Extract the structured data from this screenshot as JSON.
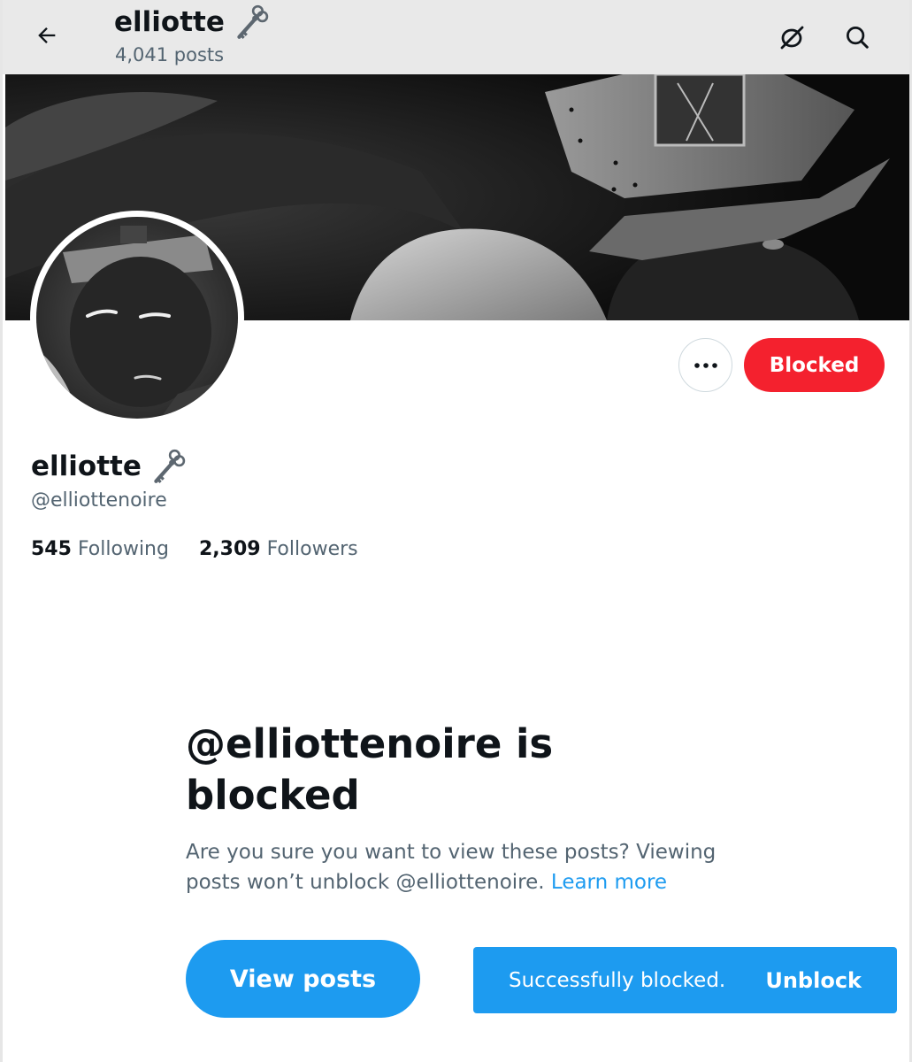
{
  "header": {
    "title": "elliotte",
    "posts_count": "4,041 posts"
  },
  "icons": {
    "back": "arrow-left-icon",
    "notifications_off": "bell-slash-icon",
    "search": "search-icon",
    "more": "more-horizontal-icon",
    "name_emoji": "old-key-icon"
  },
  "profile": {
    "name": "elliotte",
    "handle": "@elliottenoire",
    "following_count": "545",
    "following_label": "Following",
    "followers_count": "2,309",
    "followers_label": "Followers"
  },
  "actions": {
    "blocked_label": "Blocked"
  },
  "blocked_notice": {
    "title": "@elliottenoire is blocked",
    "description": "Are you sure you want to view these posts? Viewing posts won’t unblock @elliottenoire.",
    "learn_more": "Learn more",
    "view_posts_label": "View posts"
  },
  "toast": {
    "message": "Successfully blocked.",
    "action": "Unblock"
  },
  "colors": {
    "accent": "#1d9bf0",
    "blocked_red": "#f4212e",
    "secondary_text": "#536471"
  }
}
